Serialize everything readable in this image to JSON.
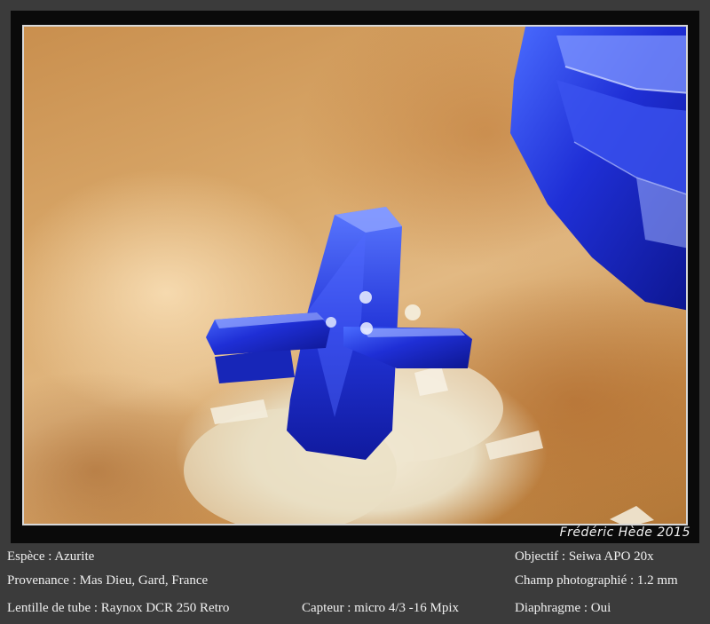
{
  "photo": {
    "subject": "azurite-crystal-cross",
    "signature": "Frédéric Hède 2015"
  },
  "caption": {
    "espece": "Espèce : Azurite",
    "provenance": "Provenance : Mas Dieu, Gard, France",
    "lentille": "Lentille de tube : Raynox DCR 250 Retro",
    "capteur": "Capteur : micro 4/3 -16 Mpix",
    "objectif": "Objectif : Seiwa APO 20x",
    "champ": "Champ photographié : 1.2 mm",
    "diaphragme": "Diaphragme : Oui"
  },
  "colors": {
    "background": "#3b3b3b",
    "frame": "#0a0a0a",
    "azurite_blue": "#1d2fd0",
    "matrix_tan": "#d9a86a"
  }
}
